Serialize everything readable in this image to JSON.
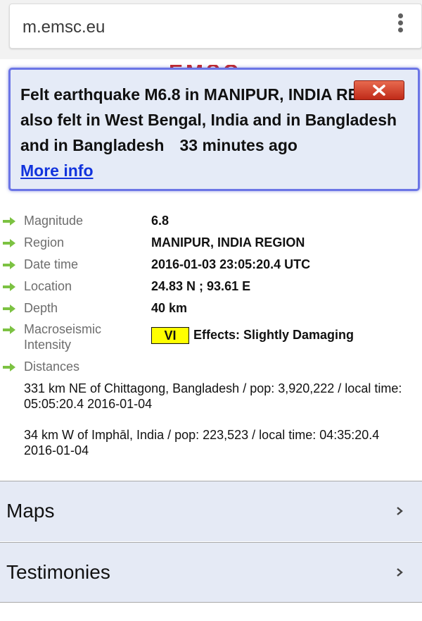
{
  "browser": {
    "url": "m.emsc.eu",
    "menu_icon": "more-vert-icon"
  },
  "logo": {
    "peek_text": "EMSC"
  },
  "alert": {
    "message": "Felt earthquake M6.8 in MANIPUR, INDIA REGION also felt in West Bengal, India and in Bangladesh and in Bangladesh",
    "time_ago": "33 minutes ago",
    "more_link": "More info",
    "close_icon": "close-x-icon",
    "border_color": "#6b75e6",
    "background": "#e5ebf7",
    "close_color": "#c02a18"
  },
  "details": {
    "rows": [
      {
        "label": "Magnitude",
        "value": "6.8"
      },
      {
        "label": "Region",
        "value": "MANIPUR, INDIA REGION"
      },
      {
        "label": "Date time",
        "value": "2016-01-03 23:05:20.4 UTC"
      },
      {
        "label": "Location",
        "value": "24.83 N ; 93.61 E"
      },
      {
        "label": "Depth",
        "value": "40 km"
      }
    ],
    "intensity": {
      "label_line1": "Macroseismic",
      "label_line2": "Intensity",
      "level": "VI",
      "effects": "Effects: Slightly Damaging",
      "badge_color": "#ffff00"
    },
    "distances_label": "Distances",
    "distances": [
      {
        "line1": "331 km NE of Chittagong, Bangladesh / pop: 3,920,222 / local time:",
        "line2": "05:05:20.4 2016-01-04"
      },
      {
        "line1": "34 km W of Imphāl, India / pop: 223,523 / local time: 04:35:20.4",
        "line2": "2016-01-04"
      }
    ],
    "arrow_icon": "green-arrow-icon",
    "arrow_color": "#7cc242"
  },
  "sections": [
    {
      "label": "Maps",
      "icon": "chevron-right-icon"
    },
    {
      "label": "Testimonies",
      "icon": "chevron-right-icon"
    }
  ]
}
